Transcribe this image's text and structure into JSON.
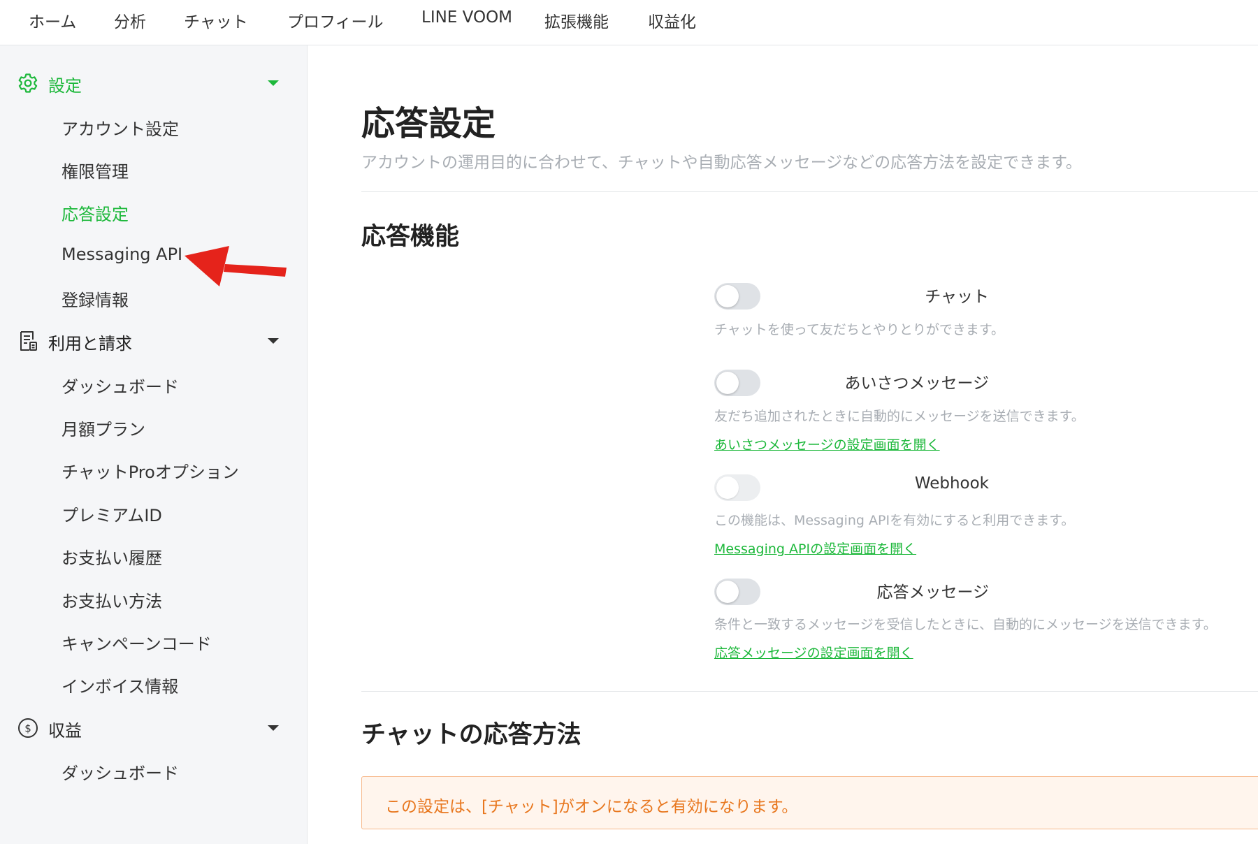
{
  "topnav": {
    "items": [
      "ホーム",
      "分析",
      "チャット",
      "プロフィール",
      "LINE VOOM",
      "拡張機能",
      "収益化"
    ]
  },
  "sidebar": {
    "settings": {
      "label": "設定",
      "icon": "gear-icon",
      "items": [
        "アカウント設定",
        "権限管理",
        "応答設定",
        "Messaging API",
        "登録情報"
      ],
      "active_item": "応答設定"
    },
    "billing": {
      "label": "利用と請求",
      "icon": "invoice-icon",
      "items": [
        "ダッシュボード",
        "月額プラン",
        "チャットProオプション",
        "プレミアムID",
        "お支払い履歴",
        "お支払い方法",
        "キャンペーンコード",
        "インボイス情報"
      ]
    },
    "revenue": {
      "label": "収益",
      "icon": "dollar-circle-icon",
      "items": [
        "ダッシュボード"
      ]
    }
  },
  "main": {
    "title": "応答設定",
    "description": "アカウントの運用目的に合わせて、チャットや自動応答メッセージなどの応答方法を設定できます。",
    "features_title": "応答機能",
    "features": {
      "chat": {
        "label": "チャット",
        "enabled": false,
        "description": "チャットを使って友だちとやりとりができます。"
      },
      "greeting": {
        "label": "あいさつメッセージ",
        "enabled": false,
        "description": "友だち追加されたときに自動的にメッセージを送信できます。",
        "link": "あいさつメッセージの設定画面を開く"
      },
      "webhook": {
        "label": "Webhook",
        "enabled": false,
        "disabled": true,
        "description": "この機能は、Messaging APIを有効にすると利用できます。",
        "link": "Messaging APIの設定画面を開く"
      },
      "auto_reply": {
        "label": "応答メッセージ",
        "enabled": false,
        "description": "条件と一致するメッセージを受信したときに、自動的にメッセージを送信できます。",
        "link": "応答メッセージの設定画面を開く"
      }
    },
    "chat_method_title": "チャットの応答方法",
    "notice": "この設定は、[チャット]がオンになると有効になります。"
  },
  "colors": {
    "accent": "#1db83b",
    "annotation_arrow": "#e5231b",
    "notice_text": "#e8771e"
  }
}
